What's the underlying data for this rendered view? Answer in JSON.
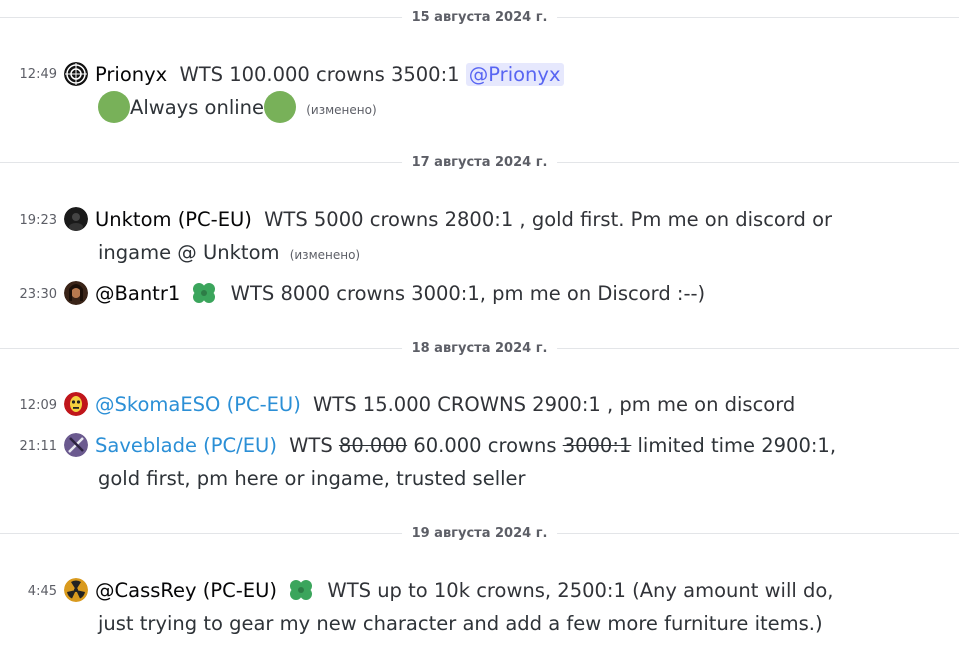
{
  "dates": [
    {
      "label": "15 августа 2024 г."
    },
    {
      "label": "17 августа 2024 г."
    },
    {
      "label": "18 августа 2024 г."
    },
    {
      "label": "19 августа 2024 г."
    }
  ],
  "edited_label": "(изменено)",
  "messages": [
    {
      "time": "12:49",
      "user": "Prionyx",
      "text": "WTS 100.000 crowns 3500:1",
      "mention": "@Prionyx",
      "line2": "Always online"
    },
    {
      "time": "19:23",
      "user": "Unktom (PC-EU)",
      "text": "WTS 5000 crowns 2800:1 , gold first. Pm me on discord or",
      "line2": "ingame @ Unktom"
    },
    {
      "time": "23:30",
      "user": "@Bantr1",
      "text": "WTS 8000 crowns 3000:1, pm me on Discord :--)"
    },
    {
      "time": "12:09",
      "user": "@SkomaESO (PC-EU)",
      "text": "WTS 15.000 CROWNS 2900:1 , pm me on discord"
    },
    {
      "time": "21:11",
      "user": "Saveblade (PC/EU)",
      "text_a": "WTS",
      "text_strike1": "80.000",
      "text_b": "60.000 crowns",
      "text_strike2": "3000:1",
      "text_c": "limited time 2900:1,",
      "line2": "gold first, pm here or ingame, trusted seller"
    },
    {
      "time": "4:45",
      "user": "@CassRey (PC-EU)",
      "text": "WTS up to 10k crowns, 2500:1 (Any amount will do,",
      "line2": "just trying to gear my new character and add a few more furniture items.)"
    }
  ],
  "icons": {
    "prionyx_avatar": "target-avatar-icon",
    "unktom_avatar": "dark-avatar-icon",
    "bantr1_avatar": "portrait-avatar-icon",
    "skoma_avatar": "red-mask-avatar-icon",
    "saveblade_avatar": "sword-avatar-icon",
    "cassrey_avatar": "radiation-avatar-icon",
    "role_badge": "clover-icon"
  },
  "colors": {
    "accent_mention": "#5865f2",
    "username_blue": "#2b8fd6",
    "online_dot": "#78b159",
    "clover": "#3ba55c"
  }
}
